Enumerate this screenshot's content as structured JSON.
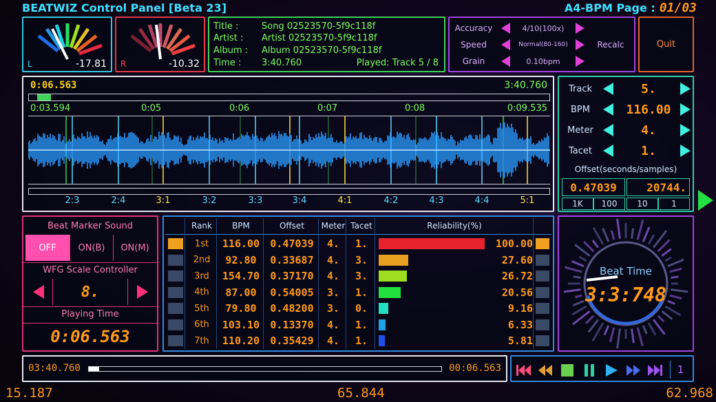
{
  "header": {
    "title": "BEATWIZ Control Panel [Beta 23]",
    "page_label": "A4-BPM Page :",
    "page_num": "01/03"
  },
  "meters": {
    "left": {
      "label": "L",
      "value": "-17.81"
    },
    "right": {
      "label": "R",
      "value": "-10.32"
    }
  },
  "info": {
    "title_label": "Title :",
    "title": "Song 02523570-5f9c118f",
    "artist_label": "Artist :",
    "artist": "Artist 02523570-5f9c118f",
    "album_label": "Album :",
    "album": "Album 02523570-5f9c118f",
    "time_label": "Time :",
    "time": "3:40.760",
    "played": "Played: Track 5 / 8"
  },
  "settings": {
    "accuracy_label": "Accuracy",
    "accuracy_value": "4/10(100x)",
    "speed_label": "Speed",
    "speed_value": "Normal(80-160)",
    "grain_label": "Grain",
    "grain_value": "0.10bpm",
    "recalc": "Recalc"
  },
  "quit": "Quit",
  "waveform": {
    "pos_time": "0:06.563",
    "end_time": "3:40.760",
    "left_time": "0:03.594",
    "right_time": "0:09.535",
    "tick_labels": [
      "0:05",
      "0:06",
      "0:07",
      "0:08"
    ],
    "beat_labels": [
      "2:3",
      "2:4",
      "3:1",
      "3:2",
      "3:3",
      "3:4",
      "4:1",
      "4:2",
      "4:3",
      "4:4",
      "5:1"
    ]
  },
  "track_panel": {
    "track_label": "Track",
    "track_value": "5.",
    "bpm_label": "BPM",
    "bpm_value": "116.00",
    "meter_label": "Meter",
    "meter_value": "4.",
    "tacet_label": "Tacet",
    "tacet_value": "1.",
    "offset_label": "Offset(seconds/samples)",
    "offset_seconds": "0.47039",
    "offset_samples": "20744.",
    "steps": [
      "1K",
      "100",
      "10",
      "1"
    ]
  },
  "beat_marker": {
    "title": "Beat Marker Sound",
    "options": [
      "OFF",
      "ON(B)",
      "ON(M)"
    ],
    "selected": "OFF",
    "wfg_title": "WFG Scale Controller",
    "wfg_value": "8.",
    "playing_title": "Playing Time",
    "playing_value": "0:06.563"
  },
  "table": {
    "headers": [
      "Rank",
      "BPM",
      "Offset",
      "Meter",
      "Tacet",
      "Reliability(%)"
    ],
    "rows": [
      {
        "rank": "1st",
        "bpm": "116.00",
        "offset": "0.47039",
        "meter": "4.",
        "tacet": "1.",
        "reliability": "100.00",
        "pct": 100,
        "color": "#e8232e"
      },
      {
        "rank": "2nd",
        "bpm": "92.80",
        "offset": "0.33687",
        "meter": "4.",
        "tacet": "3.",
        "reliability": "27.60",
        "pct": 27.6,
        "color": "#e8a020"
      },
      {
        "rank": "3rd",
        "bpm": "154.70",
        "offset": "0.37170",
        "meter": "4.",
        "tacet": "3.",
        "reliability": "26.72",
        "pct": 26.72,
        "color": "#9ee020"
      },
      {
        "rank": "4th",
        "bpm": "87.00",
        "offset": "0.54005",
        "meter": "3.",
        "tacet": "1.",
        "reliability": "20.56",
        "pct": 20.56,
        "color": "#22e040"
      },
      {
        "rank": "5th",
        "bpm": "79.80",
        "offset": "0.48200",
        "meter": "3.",
        "tacet": "0.",
        "reliability": "9.16",
        "pct": 9.16,
        "color": "#20e0c0"
      },
      {
        "rank": "6th",
        "bpm": "103.10",
        "offset": "0.13370",
        "meter": "4.",
        "tacet": "1.",
        "reliability": "6.33",
        "pct": 6.33,
        "color": "#20a0e8"
      },
      {
        "rank": "7th",
        "bpm": "110.20",
        "offset": "0.35429",
        "meter": "4.",
        "tacet": "1.",
        "reliability": "5.81",
        "pct": 5.81,
        "color": "#2050e8"
      }
    ]
  },
  "beat_time": {
    "label": "Beat Time",
    "value": "3:3:748"
  },
  "timeline": {
    "total": "03:40.760",
    "current": "00:06.563",
    "progress": 0.0297
  },
  "transport": {
    "track_num": "1"
  },
  "footer": {
    "left": "15.187",
    "center": "65.844",
    "right": "62.968"
  },
  "colors": {
    "accent_orange": "#ff9a1a",
    "cyan": "#37c7e0",
    "magenta": "#e042d8"
  }
}
